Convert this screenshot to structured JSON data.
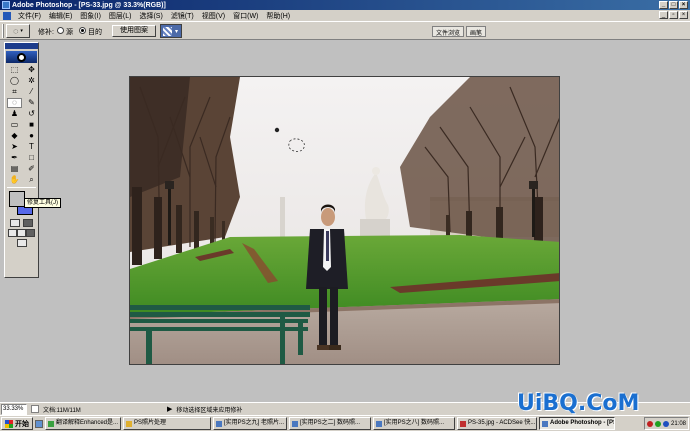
{
  "window": {
    "title": "Adobe Photoshop - [PS-33.jpg @ 33.3%(RGB)]"
  },
  "menu": [
    "文件(F)",
    "编辑(E)",
    "图象(I)",
    "图层(L)",
    "选择(S)",
    "滤镜(T)",
    "视图(V)",
    "窗口(W)",
    "帮助(H)"
  ],
  "options": {
    "patch_label": "修补:",
    "source_label": "源",
    "destination_label": "目的",
    "use_pattern_button": "使用图案",
    "palette_tabs": [
      "文件浏览",
      "画笔"
    ]
  },
  "toolbox": {
    "tooltip": "修复工具(J)"
  },
  "status": {
    "zoom": "33.33%",
    "doc": "文档:11M/11M",
    "hint": "移动选择区域来应用修补"
  },
  "taskbar": {
    "start": "开始",
    "tasks": [
      "翻译解释Enhanced是...",
      "PS照片处理",
      "[实用PS之九] 老照片...",
      "[实用PS之二] 数码照...",
      "[实用PS之八] 数码照...",
      "PS-35.jpg - ACDSee 快...",
      "Adobe Photoshop - [PS..."
    ],
    "clock": "21:08"
  },
  "watermark": "UiBQ.CoM",
  "colors": {
    "titlebar": "#0a246a",
    "face": "#d4d0c8",
    "workspace": "#c0c0c0",
    "background_color": "#5668e8",
    "watermark": "#1a6fd0"
  }
}
